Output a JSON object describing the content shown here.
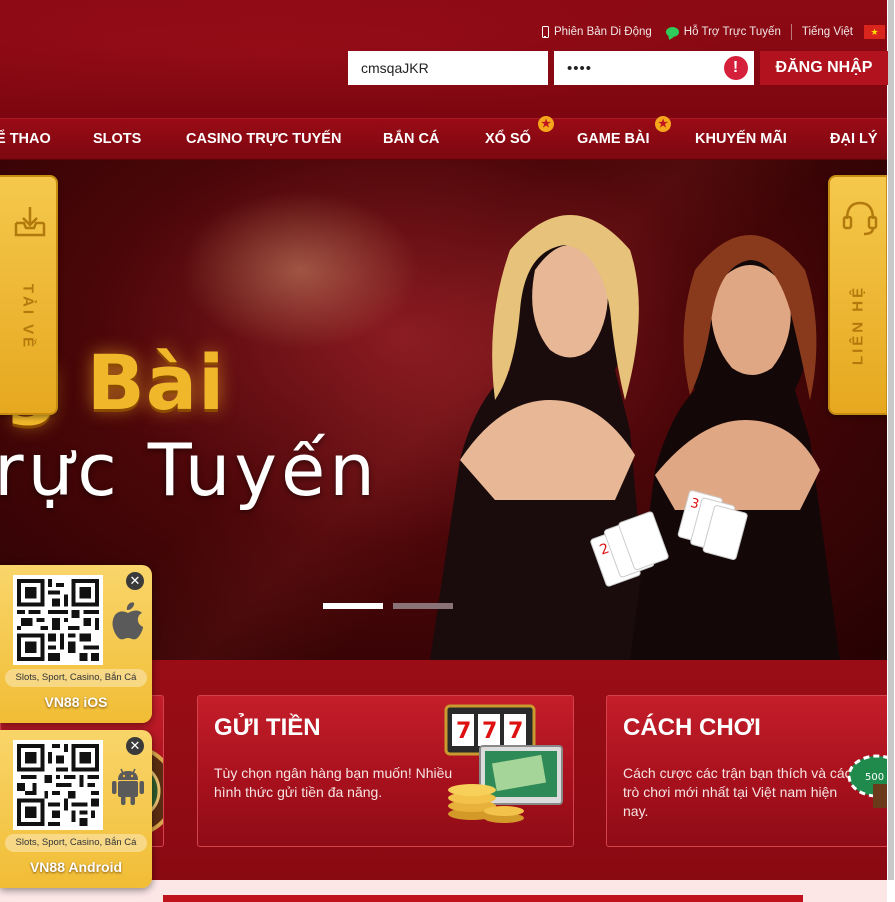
{
  "header": {
    "mobile_version": "Phiên Bản Di Động",
    "live_support": "Hỗ Trợ Trực Tuyến",
    "language": "Tiếng Việt"
  },
  "login": {
    "username": "cmsqaJKR",
    "password_masked": "••••",
    "login_button": "ĐĂNG NHẬP"
  },
  "nav": {
    "items": [
      {
        "label": "Ể THAO",
        "starred": false
      },
      {
        "label": "SLOTS",
        "starred": false
      },
      {
        "label": "CASINO TRỰC TUYẾN",
        "starred": false
      },
      {
        "label": "BẮN CÁ",
        "starred": false
      },
      {
        "label": "XỔ SỐ",
        "starred": true
      },
      {
        "label": "GAME BÀI",
        "starred": true
      },
      {
        "label": "KHUYẾN MÃI",
        "starred": false
      },
      {
        "label": "ĐẠI LÝ",
        "starred": false
      }
    ]
  },
  "banner": {
    "headline_gold": "g Bài",
    "headline_white": "rực Tuyến",
    "slide_count": 2,
    "active_slide": 1
  },
  "side_tabs": {
    "download": "TẢI VỀ",
    "contact": "LIÊN HỆ"
  },
  "cards": [
    {
      "title": "GỬI TIỀN",
      "text": "Tùy chọn ngân hàng bạn muốn! Nhiều hình thức gửi tiền đa năng."
    },
    {
      "title": "CÁCH CHƠI",
      "text": "Cách cược các trận bạn thích và các trò chơi mới nhất tại Việt nam hiện nay."
    }
  ],
  "qr_popups": [
    {
      "tags": "Slots, Sport, Casino, Bắn Cá",
      "name": "VN88 iOS",
      "os_icon": "apple-icon"
    },
    {
      "tags": "Slots, Sport, Casino, Bắn Cá",
      "name": "VN88 Android",
      "os_icon": "android-icon"
    }
  ],
  "colors": {
    "brand_red": "#8a0a12",
    "gold": "#f0b72a",
    "button_red": "#b1121e",
    "alert_red": "#d4203a"
  }
}
